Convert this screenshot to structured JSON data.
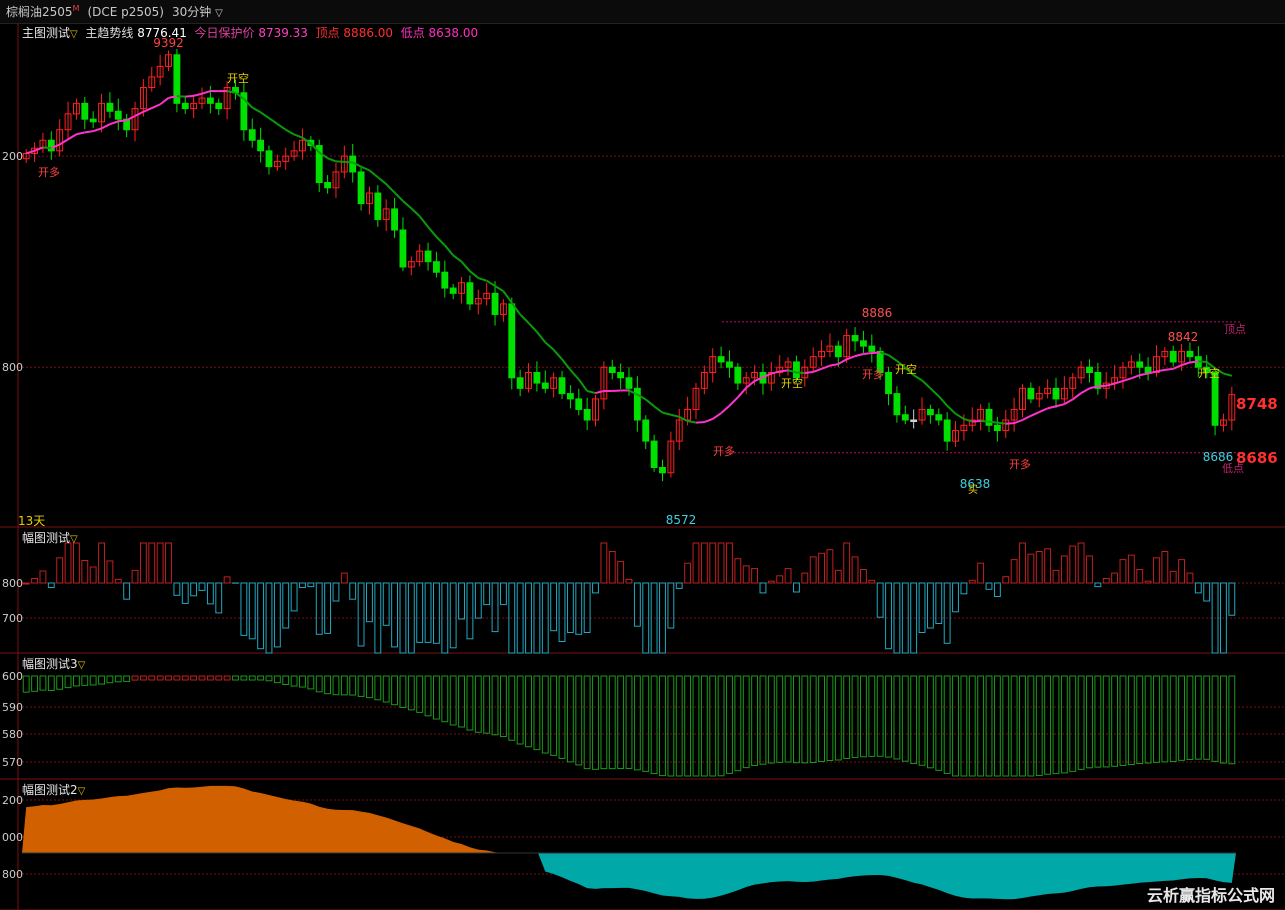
{
  "header": {
    "symbol": "棕榈油2505",
    "symbol_sup": "M",
    "exchange": "(DCE p2505)",
    "period": "30分钟"
  },
  "main_panel": {
    "title": "主图测试",
    "trend_label": "主趋势线",
    "trend_value": "8776.41",
    "protect_label": "今日保护价",
    "protect_value": "8739.33",
    "top_label": "顶点",
    "top_value": "8886.00",
    "low_label": "低点",
    "low_value": "8638.00",
    "days_label": "13天",
    "price_labels": [
      "9392",
      "8886",
      "8842",
      "8572",
      "8638",
      "8686"
    ],
    "last_price": "8748",
    "last_low": "8686",
    "signal_open_long": "开多",
    "signal_open_short": "开空",
    "right_top": "顶点",
    "right_low": "低点",
    "axis_labels": [
      "200",
      "800"
    ],
    "small_mark": "买"
  },
  "panel2": {
    "title": "幅图测试",
    "axis_labels": [
      "800",
      "700"
    ]
  },
  "panel3": {
    "title": "幅图测试3",
    "axis_labels": [
      "600",
      "590",
      "580",
      "570"
    ]
  },
  "panel4": {
    "title": "幅图测试2",
    "axis_labels": [
      "200",
      "000",
      "800"
    ]
  },
  "watermark": "云析赢指标公式网",
  "colors": {
    "up": "#ff2020",
    "down": "#00e000",
    "neutral": "#d0d0d0",
    "ma_green": "#0a9a0a",
    "ma_magenta": "#ff33cc",
    "orange": "#d06000",
    "teal": "#00a8a8"
  },
  "chart_data": [
    {
      "type": "candlestick",
      "title": "主图测试",
      "ylim": [
        8520,
        9420
      ],
      "close": [
        9205,
        9215,
        9230,
        9210,
        9250,
        9280,
        9300,
        9270,
        9265,
        9300,
        9285,
        9270,
        9250,
        9290,
        9330,
        9350,
        9370,
        9392,
        9300,
        9290,
        9300,
        9310,
        9300,
        9290,
        9330,
        9320,
        9250,
        9230,
        9210,
        9180,
        9190,
        9200,
        9210,
        9230,
        9220,
        9150,
        9140,
        9170,
        9200,
        9170,
        9110,
        9130,
        9080,
        9100,
        9060,
        8990,
        9000,
        9020,
        9000,
        8980,
        8950,
        8940,
        8960,
        8920,
        8930,
        8940,
        8900,
        8920,
        8780,
        8760,
        8790,
        8770,
        8760,
        8780,
        8750,
        8740,
        8720,
        8700,
        8740,
        8800,
        8790,
        8780,
        8760,
        8700,
        8660,
        8610,
        8600,
        8660,
        8700,
        8720,
        8760,
        8790,
        8820,
        8810,
        8800,
        8770,
        8780,
        8790,
        8770,
        8790,
        8800,
        8810,
        8780,
        8800,
        8820,
        8830,
        8840,
        8820,
        8860,
        8850,
        8840,
        8830,
        8790,
        8750,
        8710,
        8700,
        8700,
        8720,
        8710,
        8700,
        8660,
        8680,
        8690,
        8700,
        8720,
        8690,
        8680,
        8700,
        8720,
        8760,
        8740,
        8750,
        8760,
        8740,
        8760,
        8780,
        8800,
        8790,
        8760,
        8770,
        8780,
        8800,
        8810,
        8800,
        8790,
        8820,
        8830,
        8810,
        8830,
        8820,
        8800,
        8790,
        8690,
        8700,
        8748
      ],
      "ma_trend_end": 8776.41,
      "top": 8886,
      "low": 8638,
      "annotated_highs": [
        9392,
        8886,
        8842
      ],
      "annotated_lows": [
        8572,
        8638,
        8686
      ]
    },
    {
      "type": "bar",
      "title": "幅图测试",
      "ylim": [
        650,
        850
      ],
      "note": "histogram around 800 baseline"
    },
    {
      "type": "bar",
      "title": "幅图测试3",
      "ylim": [
        565,
        605
      ]
    },
    {
      "type": "area",
      "title": "幅图测试2",
      "ylim": [
        760,
        1220
      ]
    }
  ]
}
